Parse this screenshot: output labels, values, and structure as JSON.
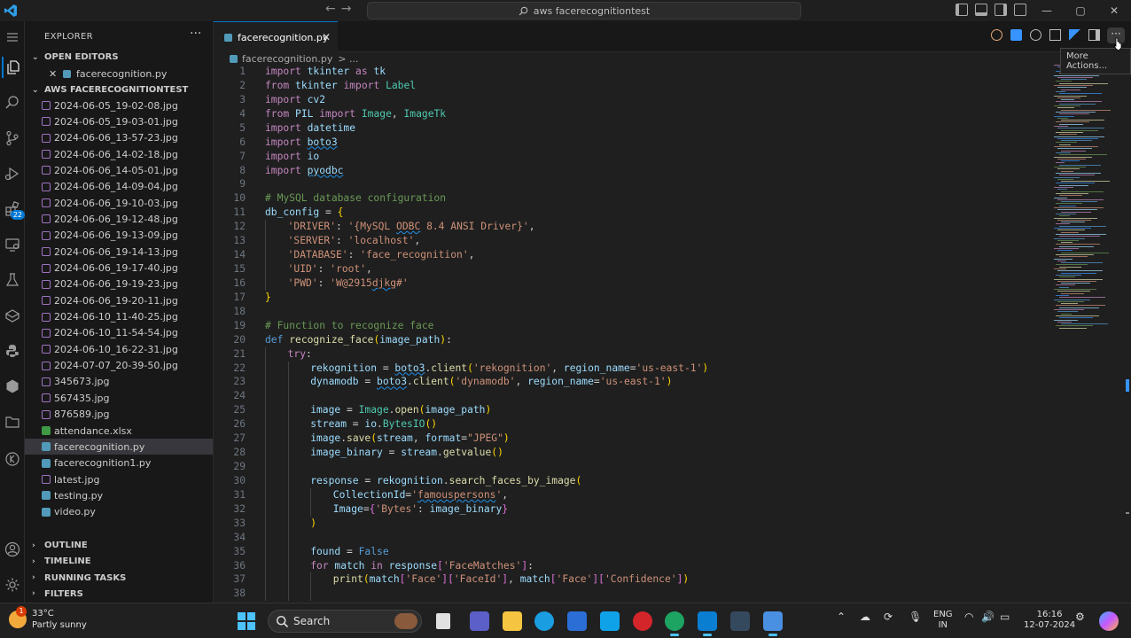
{
  "titlebar": {
    "search_text": "aws facerecognitiontest",
    "minimize": "—",
    "maximize": "▢",
    "close": "✕"
  },
  "activity": {
    "extensions_badge": "22"
  },
  "sidebar": {
    "title": "EXPLORER",
    "open_editors_label": "OPEN EDITORS",
    "open_editors": [
      {
        "name": "facerecognition.py"
      }
    ],
    "workspace_label": "AWS FACERECOGNITIONTEST",
    "files": [
      {
        "name": "2024-06-05_19-02-08.jpg",
        "type": "img"
      },
      {
        "name": "2024-06-05_19-03-01.jpg",
        "type": "img"
      },
      {
        "name": "2024-06-06_13-57-23.jpg",
        "type": "img"
      },
      {
        "name": "2024-06-06_14-02-18.jpg",
        "type": "img"
      },
      {
        "name": "2024-06-06_14-05-01.jpg",
        "type": "img"
      },
      {
        "name": "2024-06-06_14-09-04.jpg",
        "type": "img"
      },
      {
        "name": "2024-06-06_19-10-03.jpg",
        "type": "img"
      },
      {
        "name": "2024-06-06_19-12-48.jpg",
        "type": "img"
      },
      {
        "name": "2024-06-06_19-13-09.jpg",
        "type": "img"
      },
      {
        "name": "2024-06-06_19-14-13.jpg",
        "type": "img"
      },
      {
        "name": "2024-06-06_19-17-40.jpg",
        "type": "img"
      },
      {
        "name": "2024-06-06_19-19-23.jpg",
        "type": "img"
      },
      {
        "name": "2024-06-06_19-20-11.jpg",
        "type": "img"
      },
      {
        "name": "2024-06-10_11-40-25.jpg",
        "type": "img"
      },
      {
        "name": "2024-06-10_11-54-54.jpg",
        "type": "img"
      },
      {
        "name": "2024-06-10_16-22-31.jpg",
        "type": "img"
      },
      {
        "name": "2024-07-07_20-39-50.jpg",
        "type": "img"
      },
      {
        "name": "345673.jpg",
        "type": "img"
      },
      {
        "name": "567435.jpg",
        "type": "img"
      },
      {
        "name": "876589.jpg",
        "type": "img"
      },
      {
        "name": "attendance.xlsx",
        "type": "xl"
      },
      {
        "name": "facerecognition.py",
        "type": "py",
        "selected": true
      },
      {
        "name": "facerecognition1.py",
        "type": "py"
      },
      {
        "name": "latest.jpg",
        "type": "img"
      },
      {
        "name": "testing.py",
        "type": "py"
      },
      {
        "name": "video.py",
        "type": "py"
      }
    ],
    "sections": [
      "OUTLINE",
      "TIMELINE",
      "RUNNING TASKS",
      "FILTERS"
    ]
  },
  "editor": {
    "tab_label": "facerecognition.py",
    "breadcrumb_file": "facerecognition.py",
    "breadcrumb_sep": "> ...",
    "tooltip": "More Actions...",
    "more_actions": "···",
    "lines": [
      {
        "n": "1",
        "indent": 0,
        "t": [
          [
            "kw",
            "import"
          ],
          [
            "plain",
            " "
          ],
          [
            "var",
            "tkinter"
          ],
          [
            "plain",
            " "
          ],
          [
            "kw",
            "as"
          ],
          [
            "plain",
            " "
          ],
          [
            "var",
            "tk"
          ]
        ]
      },
      {
        "n": "2",
        "indent": 0,
        "t": [
          [
            "kw",
            "from"
          ],
          [
            "plain",
            " "
          ],
          [
            "var",
            "tkinter"
          ],
          [
            "plain",
            " "
          ],
          [
            "kw",
            "import"
          ],
          [
            "plain",
            " "
          ],
          [
            "cls",
            "Label"
          ]
        ]
      },
      {
        "n": "3",
        "indent": 0,
        "t": [
          [
            "kw",
            "import"
          ],
          [
            "plain",
            " "
          ],
          [
            "var",
            "cv2"
          ]
        ]
      },
      {
        "n": "4",
        "indent": 0,
        "t": [
          [
            "kw",
            "from"
          ],
          [
            "plain",
            " "
          ],
          [
            "var",
            "PIL"
          ],
          [
            "plain",
            " "
          ],
          [
            "kw",
            "import"
          ],
          [
            "plain",
            " "
          ],
          [
            "cls",
            "Image"
          ],
          [
            "plain",
            ", "
          ],
          [
            "cls",
            "ImageTk"
          ]
        ]
      },
      {
        "n": "5",
        "indent": 0,
        "t": [
          [
            "kw",
            "import"
          ],
          [
            "plain",
            " "
          ],
          [
            "var",
            "datetime"
          ]
        ]
      },
      {
        "n": "6",
        "indent": 0,
        "t": [
          [
            "kw",
            "import"
          ],
          [
            "plain",
            " "
          ],
          [
            "var squig",
            "boto3"
          ]
        ]
      },
      {
        "n": "7",
        "indent": 0,
        "t": [
          [
            "kw",
            "import"
          ],
          [
            "plain",
            " "
          ],
          [
            "var",
            "io"
          ]
        ]
      },
      {
        "n": "8",
        "indent": 0,
        "t": [
          [
            "kw",
            "import"
          ],
          [
            "plain",
            " "
          ],
          [
            "var squig",
            "pyodbc"
          ]
        ]
      },
      {
        "n": "9",
        "indent": 0,
        "t": []
      },
      {
        "n": "10",
        "indent": 0,
        "t": [
          [
            "cm",
            "# MySQL database configuration"
          ]
        ]
      },
      {
        "n": "11",
        "indent": 0,
        "t": [
          [
            "var",
            "db_config"
          ],
          [
            "plain",
            " = "
          ],
          [
            "br",
            "{"
          ]
        ]
      },
      {
        "n": "12",
        "indent": 1,
        "t": [
          [
            "str",
            "'DRIVER'"
          ],
          [
            "plain",
            ": "
          ],
          [
            "str",
            "'{MySQL "
          ],
          [
            "str squig",
            "ODBC"
          ],
          [
            "str",
            " 8.4 ANSI Driver}'"
          ],
          [
            "plain",
            ","
          ]
        ]
      },
      {
        "n": "13",
        "indent": 1,
        "t": [
          [
            "str",
            "'SERVER'"
          ],
          [
            "plain",
            ": "
          ],
          [
            "str",
            "'localhost'"
          ],
          [
            "plain",
            ","
          ]
        ]
      },
      {
        "n": "14",
        "indent": 1,
        "t": [
          [
            "str",
            "'DATABASE'"
          ],
          [
            "plain",
            ": "
          ],
          [
            "str",
            "'face_recognition'"
          ],
          [
            "plain",
            ","
          ]
        ]
      },
      {
        "n": "15",
        "indent": 1,
        "t": [
          [
            "str",
            "'UID'"
          ],
          [
            "plain",
            ": "
          ],
          [
            "str",
            "'root'"
          ],
          [
            "plain",
            ","
          ]
        ]
      },
      {
        "n": "16",
        "indent": 1,
        "t": [
          [
            "str",
            "'PWD'"
          ],
          [
            "plain",
            ": "
          ],
          [
            "str",
            "'W@2915"
          ],
          [
            "str squig",
            "djkg"
          ],
          [
            "str",
            "#'"
          ]
        ]
      },
      {
        "n": "17",
        "indent": 0,
        "t": [
          [
            "br",
            "}"
          ]
        ]
      },
      {
        "n": "18",
        "indent": 0,
        "t": []
      },
      {
        "n": "19",
        "indent": 0,
        "t": [
          [
            "cm",
            "# Function to recognize face"
          ]
        ]
      },
      {
        "n": "20",
        "indent": 0,
        "t": [
          [
            "kw2",
            "def"
          ],
          [
            "plain",
            " "
          ],
          [
            "fn",
            "recognize_face"
          ],
          [
            "br",
            "("
          ],
          [
            "var",
            "image_path"
          ],
          [
            "br",
            ")"
          ],
          [
            "plain",
            ":"
          ]
        ]
      },
      {
        "n": "21",
        "indent": 1,
        "t": [
          [
            "kw",
            "try"
          ],
          [
            "plain",
            ":"
          ]
        ]
      },
      {
        "n": "22",
        "indent": 2,
        "t": [
          [
            "var",
            "rekognition"
          ],
          [
            "plain",
            " = "
          ],
          [
            "var squig",
            "boto3"
          ],
          [
            "plain",
            "."
          ],
          [
            "fn",
            "client"
          ],
          [
            "br",
            "("
          ],
          [
            "str",
            "'rekognition'"
          ],
          [
            "plain",
            ", "
          ],
          [
            "var",
            "region_name"
          ],
          [
            "plain",
            "="
          ],
          [
            "str",
            "'us-east-1'"
          ],
          [
            "br",
            ")"
          ]
        ]
      },
      {
        "n": "23",
        "indent": 2,
        "t": [
          [
            "var",
            "dynamodb"
          ],
          [
            "plain",
            " = "
          ],
          [
            "var squig",
            "boto3"
          ],
          [
            "plain",
            "."
          ],
          [
            "fn",
            "client"
          ],
          [
            "br",
            "("
          ],
          [
            "str",
            "'dynamodb'"
          ],
          [
            "plain",
            ", "
          ],
          [
            "var",
            "region_name"
          ],
          [
            "plain",
            "="
          ],
          [
            "str",
            "'us-east-1'"
          ],
          [
            "br",
            ")"
          ]
        ]
      },
      {
        "n": "24",
        "indent": 2,
        "t": []
      },
      {
        "n": "25",
        "indent": 2,
        "t": [
          [
            "var",
            "image"
          ],
          [
            "plain",
            " = "
          ],
          [
            "cls",
            "Image"
          ],
          [
            "plain",
            "."
          ],
          [
            "fn",
            "open"
          ],
          [
            "br",
            "("
          ],
          [
            "var",
            "image_path"
          ],
          [
            "br",
            ")"
          ]
        ]
      },
      {
        "n": "26",
        "indent": 2,
        "t": [
          [
            "var",
            "stream"
          ],
          [
            "plain",
            " = "
          ],
          [
            "var",
            "io"
          ],
          [
            "plain",
            "."
          ],
          [
            "cls",
            "BytesIO"
          ],
          [
            "br",
            "()"
          ]
        ]
      },
      {
        "n": "27",
        "indent": 2,
        "t": [
          [
            "var",
            "image"
          ],
          [
            "plain",
            "."
          ],
          [
            "fn",
            "save"
          ],
          [
            "br",
            "("
          ],
          [
            "var",
            "stream"
          ],
          [
            "plain",
            ", "
          ],
          [
            "var",
            "format"
          ],
          [
            "plain",
            "="
          ],
          [
            "str",
            "\"JPEG\""
          ],
          [
            "br",
            ")"
          ]
        ]
      },
      {
        "n": "28",
        "indent": 2,
        "t": [
          [
            "var",
            "image_binary"
          ],
          [
            "plain",
            " = "
          ],
          [
            "var",
            "stream"
          ],
          [
            "plain",
            "."
          ],
          [
            "fn",
            "getvalue"
          ],
          [
            "br",
            "()"
          ]
        ]
      },
      {
        "n": "29",
        "indent": 2,
        "t": []
      },
      {
        "n": "30",
        "indent": 2,
        "t": [
          [
            "var",
            "response"
          ],
          [
            "plain",
            " = "
          ],
          [
            "var",
            "rekognition"
          ],
          [
            "plain",
            "."
          ],
          [
            "fn",
            "search_faces_by_image"
          ],
          [
            "br",
            "("
          ]
        ]
      },
      {
        "n": "31",
        "indent": 3,
        "t": [
          [
            "var",
            "CollectionId"
          ],
          [
            "plain",
            "="
          ],
          [
            "str",
            "'"
          ],
          [
            "str squig",
            "famouspersons"
          ],
          [
            "str",
            "'"
          ],
          [
            "plain",
            ","
          ]
        ]
      },
      {
        "n": "32",
        "indent": 3,
        "t": [
          [
            "var",
            "Image"
          ],
          [
            "plain",
            "="
          ],
          [
            "br2",
            "{"
          ],
          [
            "str",
            "'Bytes'"
          ],
          [
            "plain",
            ": "
          ],
          [
            "var",
            "image_binary"
          ],
          [
            "br2",
            "}"
          ]
        ]
      },
      {
        "n": "33",
        "indent": 2,
        "t": [
          [
            "br",
            ")"
          ]
        ]
      },
      {
        "n": "34",
        "indent": 2,
        "t": []
      },
      {
        "n": "35",
        "indent": 2,
        "t": [
          [
            "var",
            "found"
          ],
          [
            "plain",
            " = "
          ],
          [
            "kw2",
            "False"
          ]
        ]
      },
      {
        "n": "36",
        "indent": 2,
        "t": [
          [
            "kw",
            "for"
          ],
          [
            "plain",
            " "
          ],
          [
            "var",
            "match"
          ],
          [
            "plain",
            " "
          ],
          [
            "kw",
            "in"
          ],
          [
            "plain",
            " "
          ],
          [
            "var",
            "response"
          ],
          [
            "br2",
            "["
          ],
          [
            "str",
            "'FaceMatches'"
          ],
          [
            "br2",
            "]"
          ],
          [
            "plain",
            ":"
          ]
        ]
      },
      {
        "n": "37",
        "indent": 3,
        "t": [
          [
            "fn",
            "print"
          ],
          [
            "br",
            "("
          ],
          [
            "var",
            "match"
          ],
          [
            "br2",
            "["
          ],
          [
            "str",
            "'Face'"
          ],
          [
            "br2",
            "]["
          ],
          [
            "str",
            "'FaceId'"
          ],
          [
            "br2",
            "]"
          ],
          [
            "plain",
            ", "
          ],
          [
            "var",
            "match"
          ],
          [
            "br2",
            "["
          ],
          [
            "str",
            "'Face'"
          ],
          [
            "br2",
            "]["
          ],
          [
            "str",
            "'Confidence'"
          ],
          [
            "br2",
            "]"
          ],
          [
            "br",
            ")"
          ]
        ]
      },
      {
        "n": "38",
        "indent": 3,
        "t": []
      }
    ]
  },
  "taskbar": {
    "temperature": "33°C",
    "weather": "Partly sunny",
    "weather_alert": "1",
    "search_label": "Search",
    "lang_1": "ENG",
    "lang_2": "IN",
    "time": "16:16",
    "date": "12-07-2024"
  },
  "colors": {
    "accent": "#0078d4",
    "editor_bg": "#1f1f1f",
    "sidebar_bg": "#181818"
  }
}
